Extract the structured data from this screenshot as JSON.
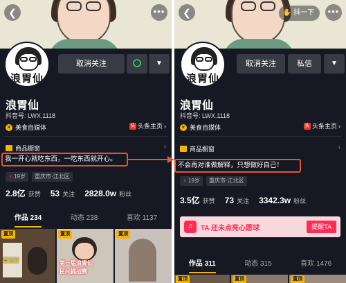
{
  "left": {
    "unfollow_label": "取消关注",
    "name": "浪胃仙",
    "uid": "抖音号: LWX.1118",
    "verified_label": "美食自媒体",
    "toutiao_label": "头条主页",
    "shop_label": "商品橱窗",
    "bio": "我一开心就吃东西，一吃东西就开心。",
    "age": "19岁",
    "location": "重庆市·江北区",
    "likes_value": "2.8亿",
    "likes_label": "获赞",
    "following_value": "53",
    "following_label": "关注",
    "followers_value": "2828.0w",
    "followers_label": "粉丝",
    "tabs": [
      "作品 234",
      "动态 238",
      "喜欢 1137"
    ],
    "pin_label": "置顶",
    "thumb1_text": "冒王打",
    "thumb2_text1": "第一届浪胃仙",
    "thumb2_text2": "民间挑战赛"
  },
  "right": {
    "poke_label": "抖一下",
    "unfollow_label": "取消关注",
    "message_label": "私信",
    "name": "浪胃仙",
    "uid": "抖音号: LWX.1118",
    "verified_label": "美食自媒体",
    "toutiao_label": "头条主页",
    "shop_label": "商品橱窗",
    "bio": "不会再对谁做解释，只想做好自己！",
    "age": "19岁",
    "location": "重庆市·江北区",
    "likes_value": "3.5亿",
    "likes_label": "获赞",
    "following_value": "73",
    "following_label": "关注",
    "followers_value": "3342.3w",
    "followers_label": "粉丝",
    "promo_text": "TA 还未点亮心愿球",
    "promo_button": "提醒TA",
    "tabs": [
      "作品 311",
      "动态 315",
      "喜欢 1476"
    ],
    "pin_label": "置顶"
  },
  "avatar_text": "浪胃仙",
  "colors": {
    "background": "#161823",
    "highlight_border": "#e4552f",
    "accent_yellow": "#f5b400",
    "douyin_red": "#fe2c55"
  }
}
